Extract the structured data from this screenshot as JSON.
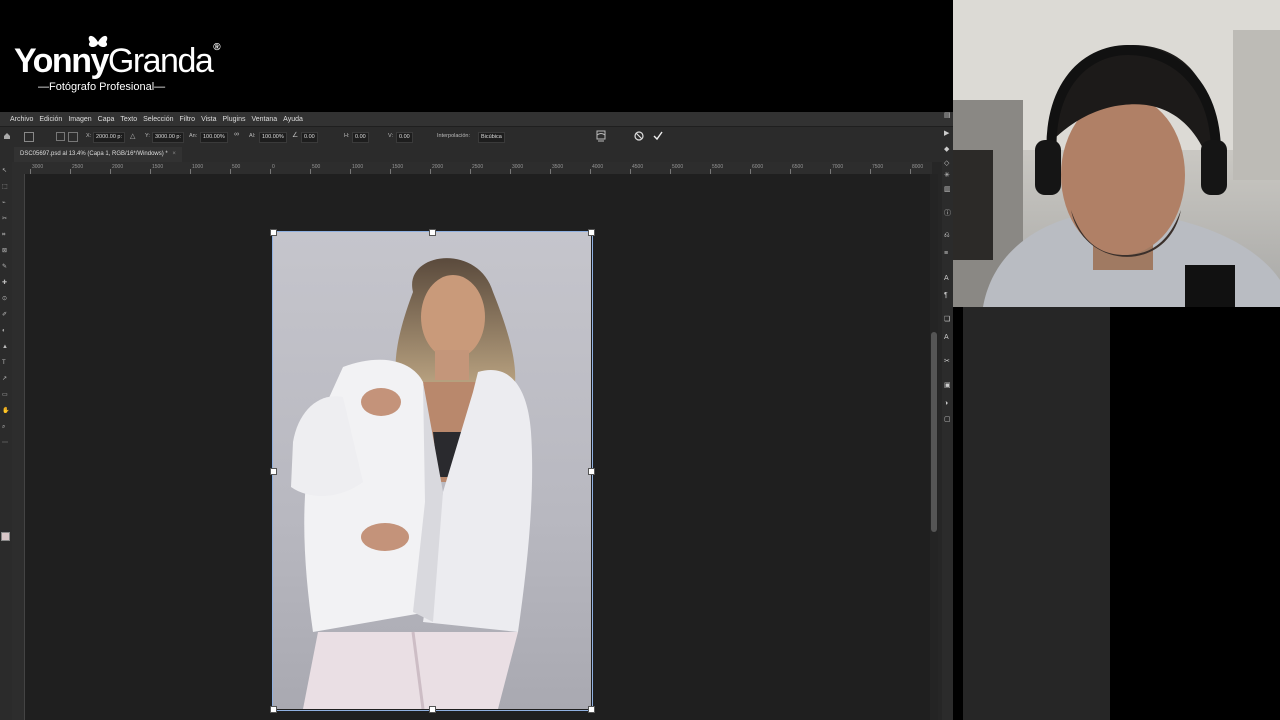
{
  "brand": {
    "name_bold": "Yonny",
    "name_light": "Granda",
    "registered": "®",
    "subtitle": "—Fotógrafo Profesional—"
  },
  "menu": [
    "Archivo",
    "Edición",
    "Imagen",
    "Capa",
    "Texto",
    "Selección",
    "Filtro",
    "Vista",
    "Plugins",
    "Ventana",
    "Ayuda"
  ],
  "options": {
    "x_label": "X:",
    "x_value": "2000.00 p:",
    "y_label": "Y:",
    "y_value": "3000.00 p:",
    "w_label": "An:",
    "w_value": "100.00%",
    "h_label": "Al:",
    "h_value": "100.00%",
    "angle_value": "0.00",
    "hskew_label": "H:",
    "hskew_value": "0.00",
    "vskew_label": "V:",
    "vskew_value": "0.00",
    "interp_label": "Interpolación:",
    "interp_value": "Bicúbica"
  },
  "document": {
    "tab_title": "DSC05697.psd al 13.4% (Capa 1, RGB/16*/Windows) *",
    "close": "×"
  },
  "ruler_labels": [
    "3000",
    "2500",
    "2000",
    "1500",
    "1000",
    "500",
    "0",
    "500",
    "1000",
    "1500",
    "2000",
    "2500",
    "3000",
    "3500",
    "4000",
    "4500",
    "5000",
    "5500",
    "6000",
    "6500",
    "7000",
    "7500",
    "8000"
  ],
  "icons": {
    "warp": "warp-icon",
    "cancel": "cancel-icon",
    "commit": "check-icon",
    "home": "home-icon"
  }
}
